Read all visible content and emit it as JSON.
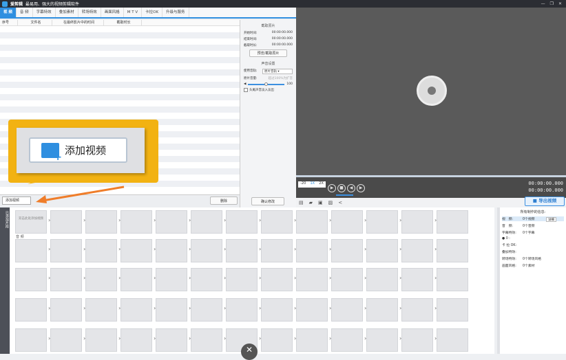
{
  "app": {
    "title": "爱剪辑",
    "subtitle": "最易用、强大的视频剪辑软件",
    "window_controls": [
      "—",
      "❐",
      "✕"
    ]
  },
  "tabs": [
    "视 频",
    "音 频",
    "字幕特效",
    "叠加素材",
    "转场特效",
    "画面风格",
    "M T V",
    "卡拉OK",
    "升级与服务"
  ],
  "table": {
    "headers": [
      "序号",
      "文件名",
      "在最终影片中的时间",
      "截取时长"
    ]
  },
  "side": {
    "clip_section": "截取原片",
    "start_label": "开始时间:",
    "end_label": "结束时间:",
    "dur_label": "截取时长:",
    "time_value": "00:00:00.000",
    "preview_btn": "预览/截取原片",
    "sound_section": "声音设置",
    "track_label": "使用音轨:",
    "track_value": "原片音轨",
    "volume_label": "原片音量:",
    "volume_hint": "超过100%为扩音",
    "volume_value": "100",
    "fade_label": "头尾声音淡入淡出",
    "confirm": "确认修改"
  },
  "player": {
    "time_current": "00:00:00.000",
    "time_total": "00:00:00.000",
    "speed": [
      "-20",
      "1X",
      "2X"
    ],
    "volume_fraction": 0.75
  },
  "toolbar": {
    "export": "导出视频"
  },
  "left": {
    "add_video": "添加视频",
    "delete": "删除",
    "vertical_tab": "已添加片段"
  },
  "grid": {
    "first_cell": "双击此处添加视频",
    "audio_label": "音 频"
  },
  "info": {
    "title": "所有制作的信息:",
    "detail_btn": "详细",
    "rows": [
      [
        "视　频:",
        "0个视频"
      ],
      [
        "音　频:",
        "0个音频"
      ],
      [
        "字幕特效:",
        "0个字幕"
      ],
      [
        "● 0 :",
        ""
      ],
      [
        "卡 拉 OK:",
        ""
      ],
      [
        "叠加特效:",
        ""
      ],
      [
        "转场特效:",
        "0个转场风格"
      ],
      [
        "画面风格:",
        "0个素材"
      ]
    ]
  },
  "callout": {
    "label": "添加视频"
  },
  "colors": {
    "accent": "#2f8fe0",
    "callout": "#f2b212",
    "arrow": "#ef7d2a"
  }
}
